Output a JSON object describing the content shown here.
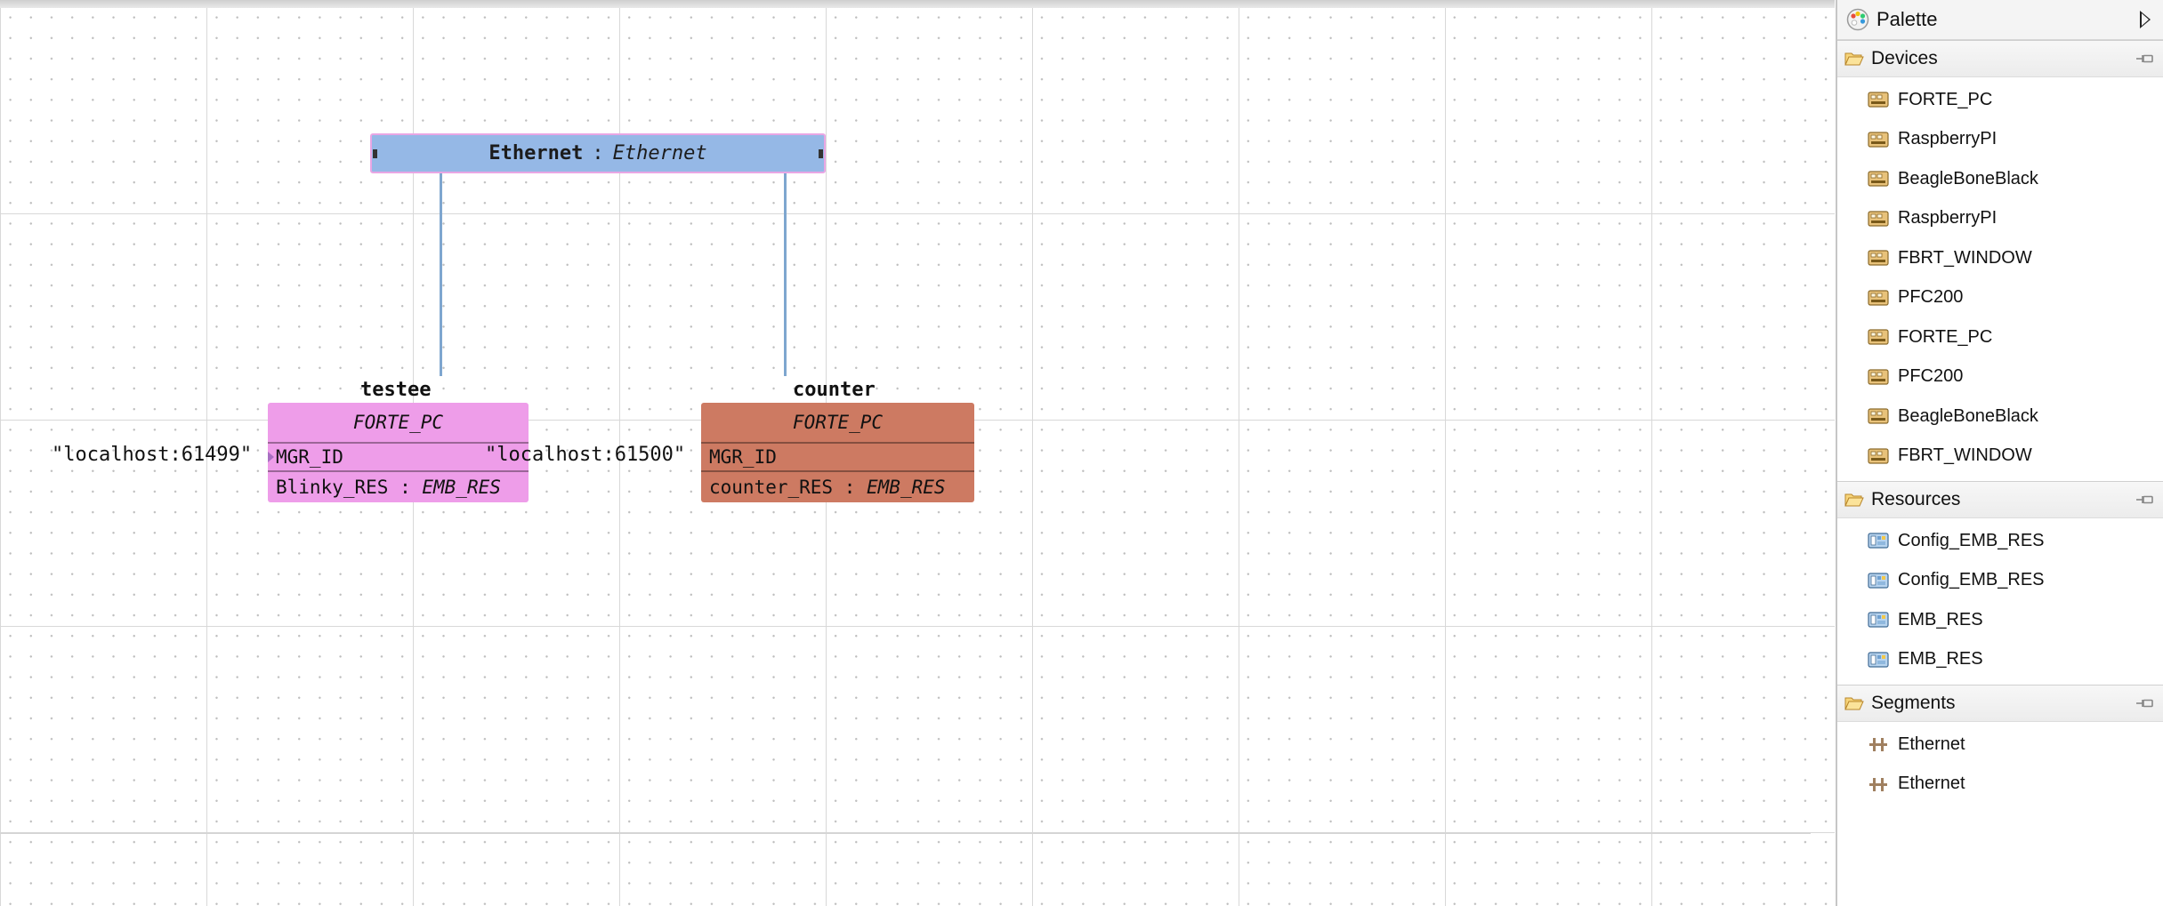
{
  "diagram": {
    "segment": {
      "name": "Ethernet",
      "separator": ":",
      "type": "Ethernet"
    },
    "devices": [
      {
        "name": "testee",
        "type": "FORTE_PC",
        "param_name": "MGR_ID",
        "param_value": "\"localhost:61499\"",
        "resource_name": "Blinky_RES",
        "resource_separator": " : ",
        "resource_type": "EMB_RES",
        "color": "#ee9de9"
      },
      {
        "name": "counter",
        "type": "FORTE_PC",
        "param_name": "MGR_ID",
        "param_value": "\"localhost:61500\"",
        "resource_name": "counter_RES",
        "resource_separator": " : ",
        "resource_type": "EMB_RES",
        "color": "#cd7a62"
      }
    ],
    "segment_color": "#95b8e6"
  },
  "palette": {
    "title": "Palette",
    "drawers": [
      {
        "title": "Devices",
        "items": [
          "FORTE_PC",
          "RaspberryPI",
          "BeagleBoneBlack",
          "RaspberryPI",
          "FBRT_WINDOW",
          "PFC200",
          "FORTE_PC",
          "PFC200",
          "BeagleBoneBlack",
          "FBRT_WINDOW"
        ]
      },
      {
        "title": "Resources",
        "items": [
          "Config_EMB_RES",
          "Config_EMB_RES",
          "EMB_RES",
          "EMB_RES"
        ]
      },
      {
        "title": "Segments",
        "items": [
          "Ethernet",
          "Ethernet"
        ]
      }
    ]
  }
}
